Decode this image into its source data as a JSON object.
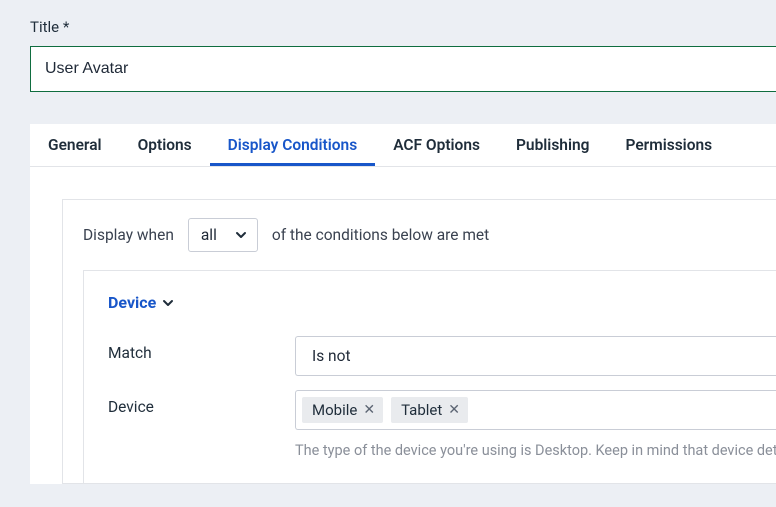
{
  "title_field": {
    "label": "Title *",
    "value": "User Avatar"
  },
  "tabs": {
    "general": "General",
    "options": "Options",
    "display_conditions": "Display Conditions",
    "acf_options": "ACF Options",
    "publishing": "Publishing",
    "permissions": "Permissions"
  },
  "conditions": {
    "prefix": "Display when",
    "mode": "all",
    "suffix": "of the conditions below are met",
    "rule": {
      "title": "Device",
      "match_label": "Match",
      "match_value": "Is not",
      "device_label": "Device",
      "device_values": {
        "0": "Mobile",
        "1": "Tablet"
      },
      "help": "The type of the device you're using is Desktop. Keep in mind that device dete"
    }
  }
}
